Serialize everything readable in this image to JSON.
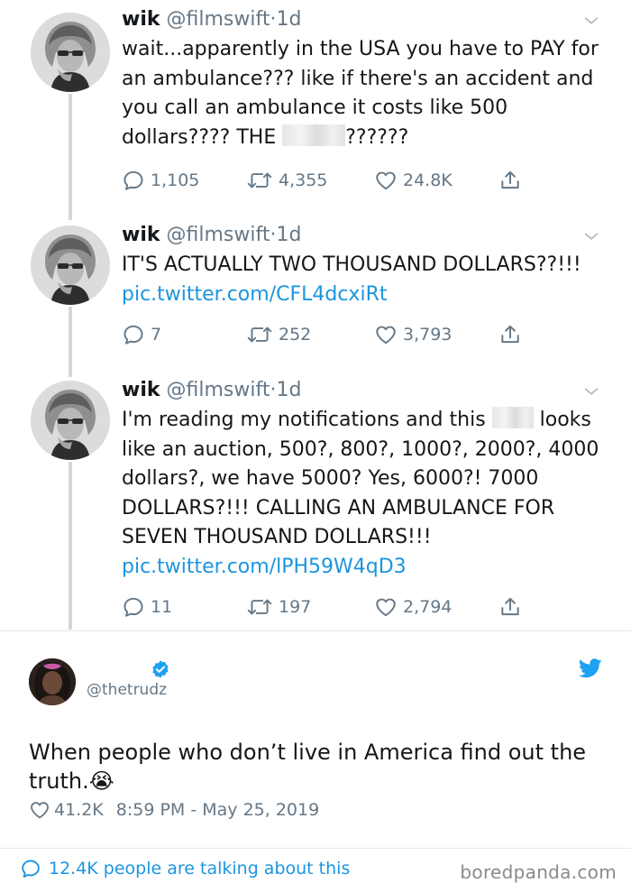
{
  "thread": {
    "tweets": [
      {
        "name": "wik",
        "handle": "@filmswift",
        "sep": "·",
        "time": "1d",
        "text_1": "wait...apparently in the USA you have to PAY for an ambulance??? like if there's an accident and you call an ambulance it costs like 500 dollars???? THE ",
        "text_2": "??????",
        "replies": "1,105",
        "retweets": "4,355",
        "likes": "24.8K"
      },
      {
        "name": "wik",
        "handle": "@filmswift",
        "sep": "·",
        "time": "1d",
        "text_1": "IT'S ACTUALLY TWO THOUSAND DOLLARS??!!! ",
        "link": "pic.twitter.com/CFL4dcxiRt",
        "replies": "7",
        "retweets": "252",
        "likes": "3,793"
      },
      {
        "name": "wik",
        "handle": "@filmswift",
        "sep": "·",
        "time": "1d",
        "text_1": "I'm reading my notifications and this ",
        "text_2": " looks like an auction, 500?, 800?, 1000?, 2000?, 4000 dollars?, we have 5000? Yes, 6000?! 7000 DOLLARS?!!! CALLING AN AMBULANCE FOR SEVEN THOUSAND DOLLARS!!! ",
        "link": "pic.twitter.com/lPH59W4qD3",
        "replies": "11",
        "retweets": "197",
        "likes": "2,794"
      }
    ]
  },
  "embed": {
    "handle": "@thetrudz",
    "text": "When people who don’t live in America find out the truth.",
    "emoji": "😭",
    "likes": "41.2K",
    "timestamp": "8:59 PM - May 25, 2019",
    "talking": "12.4K people are talking about this",
    "watermark": "boredpanda.com"
  },
  "colors": {
    "accent": "#1b95e0",
    "muted": "#657786",
    "text": "#14171a",
    "verified": "#1da1f2"
  },
  "icons": [
    "reply-icon",
    "retweet-icon",
    "like-icon",
    "share-icon",
    "chevron-down-icon",
    "verified-badge-icon",
    "twitter-bird-icon",
    "chat-bubble-icon"
  ]
}
